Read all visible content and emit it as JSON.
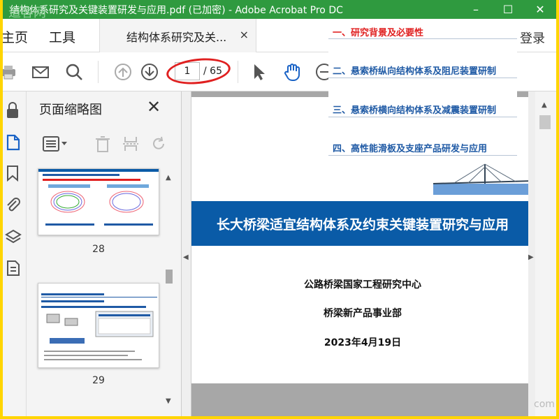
{
  "window": {
    "title": "结构体系研究及关键装置研发与应用.pdf (已加密) - Adobe Acrobat Pro DC",
    "watermark": "道客网",
    "controls": [
      "–",
      "☐",
      "✕"
    ]
  },
  "menu": {
    "home": "主页",
    "tools": "工具",
    "login": "登录"
  },
  "tab": {
    "label": "结构体系研究及关...",
    "close": "×"
  },
  "toolbar": {
    "current_page": "1",
    "total_pages": "/ 65"
  },
  "sidebar": {
    "title": "页面缩略图",
    "close": "✕",
    "thumbnails": [
      {
        "page": "28"
      },
      {
        "page": "29"
      }
    ]
  },
  "document": {
    "title": "长大桥梁适宜结构体系及约束关键装置研究与应用",
    "org1": "公路桥梁国家工程研究中心",
    "org2": "桥梁新产品事业部",
    "date": "2023年4月19日"
  },
  "toc": {
    "items": [
      "一、研究背景及必要性",
      "二、悬索桥纵向结构体系及阻尼装置研制",
      "三、悬索桥横向结构体系及减震装置研制",
      "四、高性能滑板及支座产品研发与应用"
    ],
    "active_color": "#e02020",
    "color": "#1f5aa5"
  },
  "corner_mark": "com",
  "colors": {
    "titlebar": "#2f9a3f",
    "banner": "#0a5ba7",
    "frame": "#ffd500"
  }
}
